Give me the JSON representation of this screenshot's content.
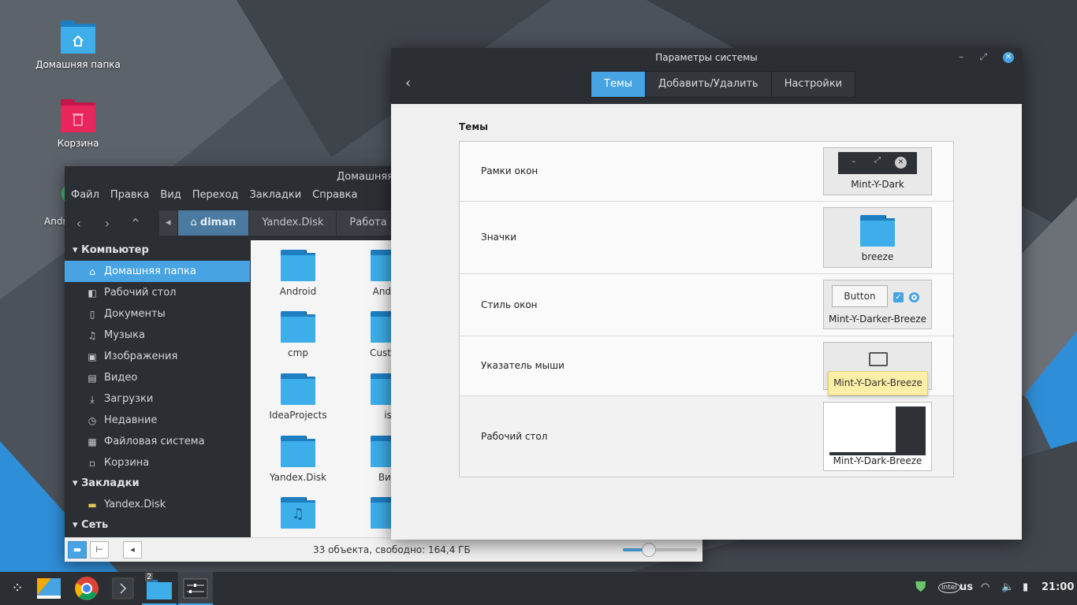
{
  "desktop": {
    "icons": [
      {
        "label": "Домашняя папка"
      },
      {
        "label": "Корзина"
      },
      {
        "label": "Andr"
      }
    ]
  },
  "file_manager": {
    "title": "Домашняя",
    "menu": [
      "Файл",
      "Правка",
      "Вид",
      "Переход",
      "Закладки",
      "Справка"
    ],
    "breadcrumbs": [
      "diman",
      "Yandex.Disk",
      "Работа"
    ],
    "sidebar": {
      "computer_header": "Компьютер",
      "computer_items": [
        "Домашняя папка",
        "Рабочий стол",
        "Документы",
        "Музыка",
        "Изображения",
        "Видео",
        "Загрузки",
        "Недавние",
        "Файловая система",
        "Корзина"
      ],
      "bookmarks_header": "Закладки",
      "bookmark_items": [
        "Yandex.Disk"
      ],
      "network_header": "Сеть"
    },
    "files": [
      "Android",
      "Androi",
      "cmp",
      "Custom",
      "IdeaProjects",
      "is",
      "Yandex.Disk",
      "Вид",
      "",
      ""
    ],
    "status_text": "33 объекта, свободно: 164,4 ГБ",
    "zoom_level": 0.35
  },
  "settings": {
    "title": "Параметры системы",
    "tabs": [
      "Темы",
      "Добавить/Удалить",
      "Настройки"
    ],
    "section_title": "Темы",
    "rows": [
      {
        "label": "Рамки окон",
        "value": "Mint-Y-Dark"
      },
      {
        "label": "Значки",
        "value": "breeze"
      },
      {
        "label": "Стиль окон",
        "value": "Mint-Y-Darker-Breeze",
        "button_label": "Button"
      },
      {
        "label": "Указатель мыши",
        "value": ""
      },
      {
        "label": "Рабочий стол",
        "value": "Mint-Y-Dark-Breeze"
      }
    ],
    "tooltip": "Mint-Y-Dark-Breeze"
  },
  "taskbar": {
    "folder_badge": "2",
    "layout": "us",
    "clock": "21:00"
  },
  "colors": {
    "accent": "#47a3e1",
    "dark_panel": "#2b2e33",
    "folder": "#3daee9"
  }
}
